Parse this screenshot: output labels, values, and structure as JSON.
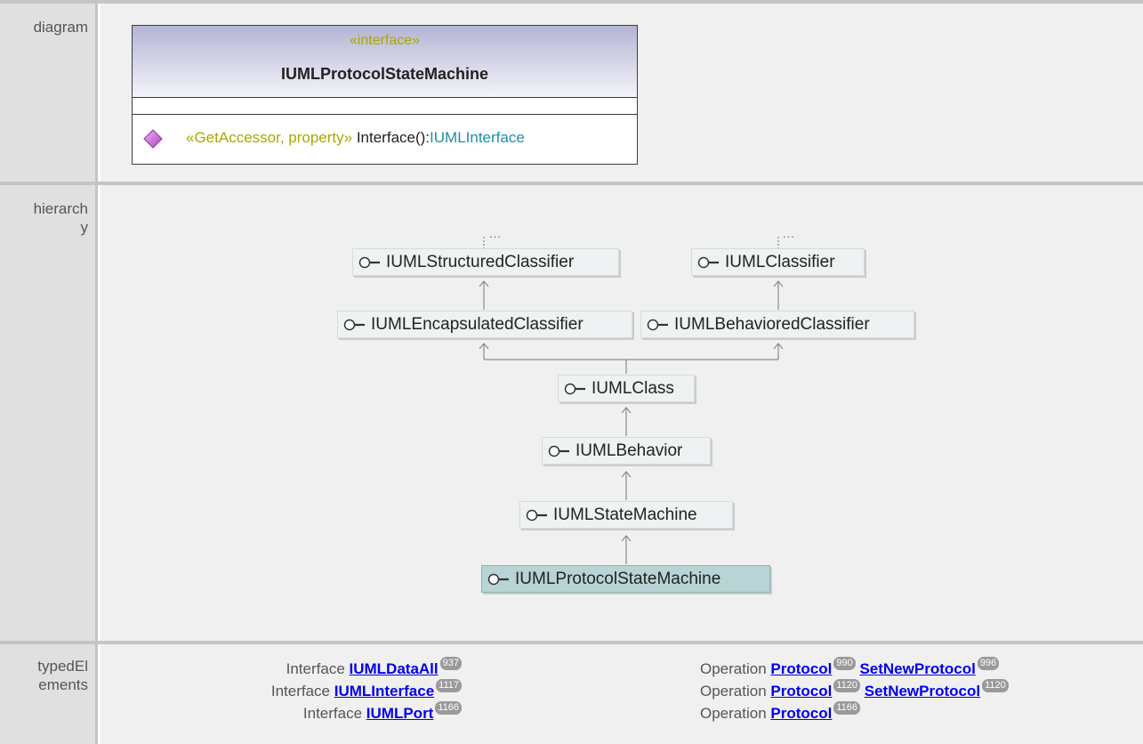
{
  "rows": {
    "diagram_label": "diagram",
    "hierarchy_label_line1": "hierarch",
    "hierarchy_label_line2": "y",
    "typed_label_line1": "typedEl",
    "typed_label_line2": "ements"
  },
  "uml": {
    "stereotype": "«interface»",
    "name": "IUMLProtocolStateMachine",
    "operation": {
      "stereotype": "«GetAccessor, property»",
      "name": "Interface():",
      "type": "IUMLInterface"
    }
  },
  "hierarchy": {
    "ellipsis": "...",
    "nodes": {
      "structured": "IUMLStructuredClassifier",
      "classifier": "IUMLClassifier",
      "encapsulated": "IUMLEncapsulatedClassifier",
      "behaviored": "IUMLBehavioredClassifier",
      "class": "IUMLClass",
      "behavior": "IUMLBehavior",
      "statemachine": "IUMLStateMachine",
      "protocol": "IUMLProtocolStateMachine"
    }
  },
  "typed_elements": {
    "left": [
      {
        "kind": "Interface",
        "name": "IUMLDataAll",
        "badge": "937"
      },
      {
        "kind": "Interface",
        "name": "IUMLInterface",
        "badge": "1117"
      },
      {
        "kind": "Interface",
        "name": "IUMLPort",
        "badge": "1166"
      }
    ],
    "right": [
      {
        "kind": "Operation",
        "name": "Protocol",
        "badge": "990",
        "name2": "SetNewProtocol",
        "badge2": "996"
      },
      {
        "kind": "Operation",
        "name": "Protocol",
        "badge": "1120",
        "name2": "SetNewProtocol",
        "badge2": "1120"
      },
      {
        "kind": "Operation",
        "name": "Protocol",
        "badge": "1166"
      }
    ]
  },
  "colors": {
    "stereotype": "#a8a800",
    "type": "#1f8fa8",
    "link": "#0000ee",
    "selected_node": "#b8d4d4"
  }
}
